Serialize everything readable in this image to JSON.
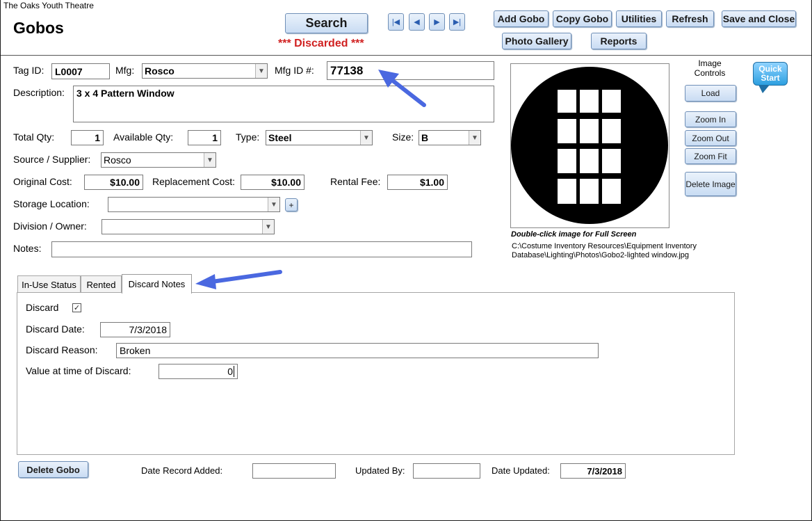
{
  "app": {
    "org_name": "The Oaks Youth Theatre",
    "form_title": "Gobos"
  },
  "header": {
    "search_label": "Search",
    "status_text": "*** Discarded ***",
    "buttons": {
      "add_gobo": "Add Gobo",
      "copy_gobo": "Copy Gobo",
      "utilities": "Utilities",
      "refresh": "Refresh",
      "save_close": "Save and Close",
      "photo_gallery": "Photo Gallery",
      "reports": "Reports"
    },
    "nav_icons": [
      "first-record-icon",
      "previous-record-icon",
      "next-record-icon",
      "last-record-icon"
    ]
  },
  "form": {
    "tag_id": {
      "label": "Tag ID:",
      "value": "L0007"
    },
    "mfg": {
      "label": "Mfg:",
      "value": "Rosco"
    },
    "mfg_id": {
      "label": "Mfg ID #:",
      "value": "77138"
    },
    "description": {
      "label": "Description:",
      "value": "3 x 4 Pattern Window"
    },
    "total_qty": {
      "label": "Total Qty:",
      "value": "1"
    },
    "available_qty": {
      "label": "Available Qty:",
      "value": "1"
    },
    "type": {
      "label": "Type:",
      "value": "Steel"
    },
    "size": {
      "label": "Size:",
      "value": "B"
    },
    "source": {
      "label": "Source / Supplier:",
      "value": "Rosco"
    },
    "original_cost": {
      "label": "Original Cost:",
      "value": "$10.00"
    },
    "replacement_cost": {
      "label": "Replacement Cost:",
      "value": "$10.00"
    },
    "rental_fee": {
      "label": "Rental Fee:",
      "value": "$1.00"
    },
    "storage_location": {
      "label": "Storage Location:",
      "value": "",
      "add_label": "+"
    },
    "division_owner": {
      "label": "Division / Owner:",
      "value": ""
    },
    "notes": {
      "label": "Notes:",
      "value": ""
    }
  },
  "image_panel": {
    "caption": "Double-click image for Full Screen",
    "path": "C:\\Costume Inventory Resources\\Equipment Inventory Database\\Lighting\\Photos\\Gobo2-lighted window.jpg",
    "controls_title": "Image Controls",
    "buttons": {
      "load": "Load",
      "zoom_in": "Zoom In",
      "zoom_out": "Zoom Out",
      "zoom_fit": "Zoom Fit",
      "delete_image": "Delete Image"
    },
    "window_grid": {
      "columns": 3,
      "rows": 4
    }
  },
  "quick_start": {
    "label_line1": "Quick",
    "label_line2": "Start"
  },
  "tabs": [
    {
      "label": "In-Use Status",
      "active": false
    },
    {
      "label": "Rented",
      "active": false
    },
    {
      "label": "Discard Notes",
      "active": true
    }
  ],
  "discard": {
    "discard_label": "Discard",
    "discard_checked": true,
    "date_label": "Discard Date:",
    "date_value": "7/3/2018",
    "reason_label": "Discard Reason:",
    "reason_value": "Broken",
    "value_label": "Value at time of Discard:",
    "value_value": "0"
  },
  "footer": {
    "delete_button": "Delete Gobo",
    "date_added_label": "Date Record Added:",
    "date_added_value": "",
    "updated_by_label": "Updated By:",
    "updated_by_value": "",
    "date_updated_label": "Date Updated:",
    "date_updated_value": "7/3/2018"
  },
  "colors": {
    "status_red": "#d02020",
    "arrow_blue": "#4a68e0",
    "button_border": "#6f8fb7"
  }
}
